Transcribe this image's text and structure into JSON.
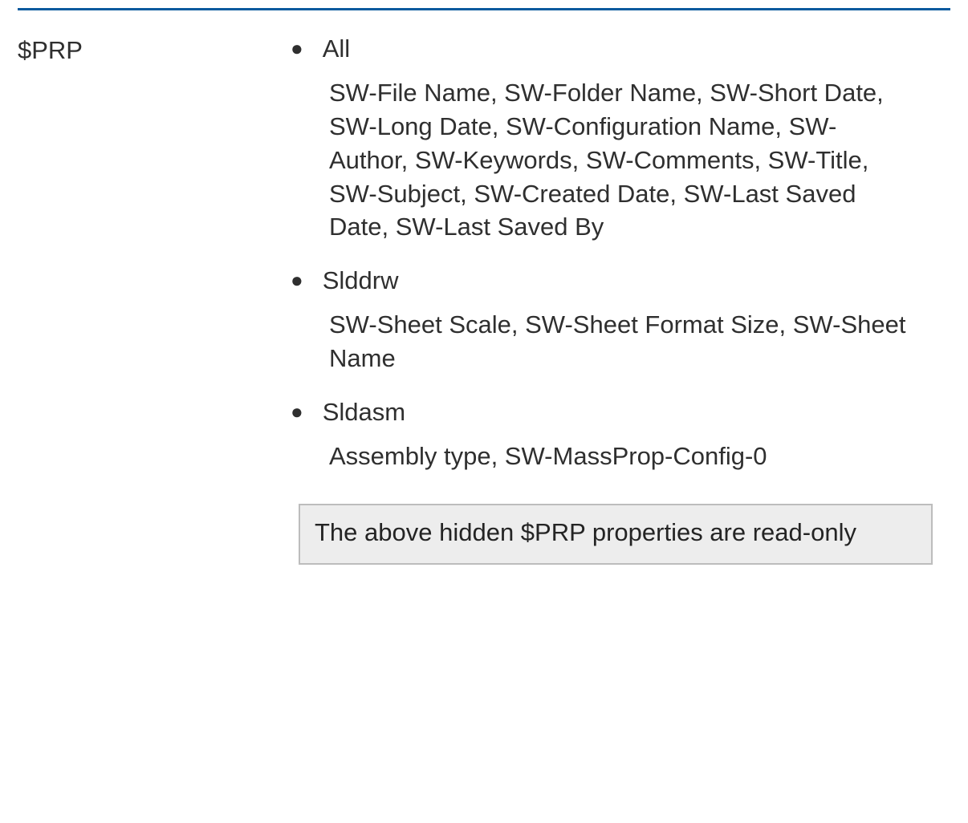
{
  "section_label": "$PRP",
  "items": [
    {
      "title": "All",
      "desc": "SW-File Name, SW-Folder Name, SW-Short Date, SW-Long Date, SW-Configuration Name, SW-Author, SW-Keywords, SW-Comments, SW-Title, SW-Subject, SW-Created Date, SW-Last Saved Date, SW-Last Saved By"
    },
    {
      "title": "Slddrw",
      "desc": "SW-Sheet Scale, SW-Sheet Format Size, SW-Sheet Name"
    },
    {
      "title": "Sldasm",
      "desc": "Assembly type, SW-MassProp-Config-0"
    }
  ],
  "note": "The above hidden $PRP properties are read-only"
}
